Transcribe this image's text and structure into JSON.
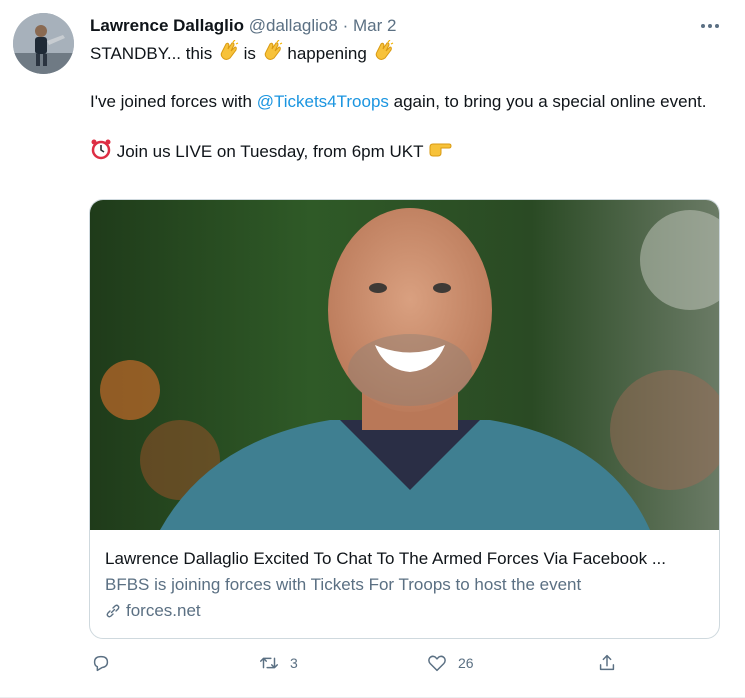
{
  "tweet": {
    "author_name": "Lawrence Dallaglio",
    "handle": "@dallaglio8",
    "separator": "·",
    "date": "Mar 2",
    "line1_a": "STANDBY... this ",
    "line1_b": " is ",
    "line1_c": " happening ",
    "line2_a": "I've joined forces with ",
    "line2_mention": "@Tickets4Troops",
    "line2_b": " again, to bring you a special online event.",
    "line3": " Join us LIVE on Tuesday, from 6pm UKT ",
    "icons": [
      "clapping-hands-icon",
      "alarm-clock-icon",
      "pointing-right-icon",
      "more-icon",
      "reply-icon",
      "retweet-icon",
      "like-icon",
      "share-icon",
      "link-icon"
    ]
  },
  "card": {
    "title": "Lawrence Dallaglio Excited To Chat To The Armed Forces Via Facebook ...",
    "description": "BFBS is joining forces with Tickets For Troops to host the event",
    "domain": "forces.net"
  },
  "actions": {
    "reply_count": "",
    "retweet_count": "3",
    "like_count": "26"
  },
  "colors": {
    "text": "#0f1419",
    "secondary": "#5b7083",
    "link": "#1b95e0",
    "border": "#cfd9de"
  }
}
